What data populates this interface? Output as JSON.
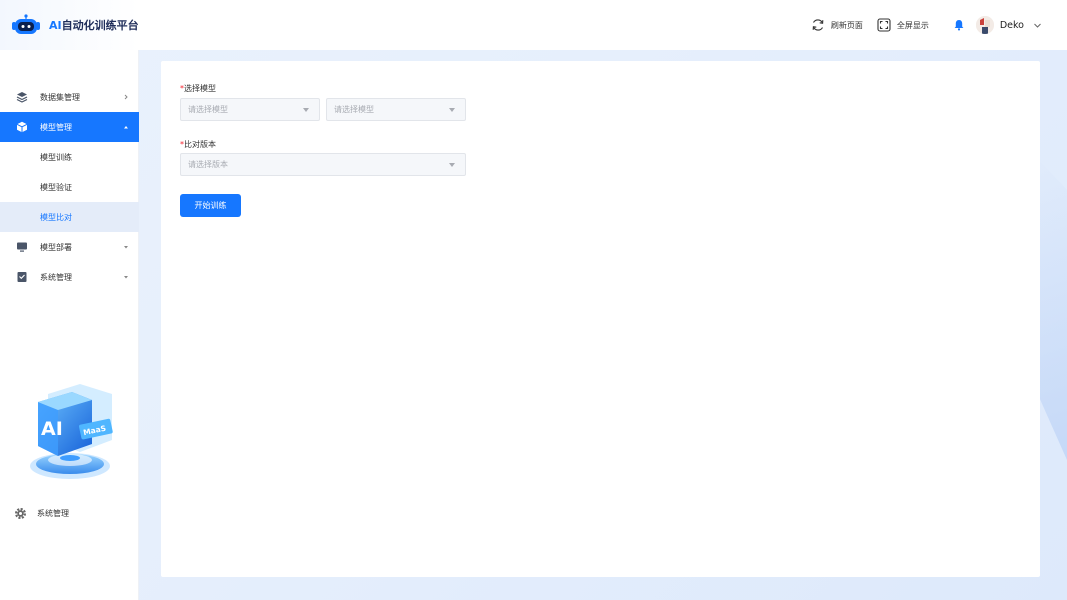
{
  "app": {
    "title_prefix": "AI",
    "title_rest": "自动化训练平台"
  },
  "header": {
    "refresh_label": "刷新页面",
    "fullscreen_label": "全屏显示",
    "user_name": "Deko"
  },
  "sidebar": {
    "items": [
      {
        "label": "数据集管理"
      },
      {
        "label": "模型管理"
      },
      {
        "label": "模型训练"
      },
      {
        "label": "模型验证"
      },
      {
        "label": "模型比对"
      },
      {
        "label": "模型部署"
      },
      {
        "label": "系统管理"
      }
    ],
    "illustration": {
      "big_text": "AI",
      "badge_text": "MaaS"
    },
    "bottom_label": "系统管理"
  },
  "form": {
    "model_label": "选择模型",
    "model_select_1_placeholder": "请选择模型",
    "model_select_2_placeholder": "请选择模型",
    "version_label": "比对版本",
    "version_select_placeholder": "请选择版本",
    "required_mark": "*",
    "start_button": "开始训练"
  },
  "colors": {
    "accent": "#1677ff",
    "required": "#f5222d",
    "active_sub_bg": "#e4ecf9"
  }
}
